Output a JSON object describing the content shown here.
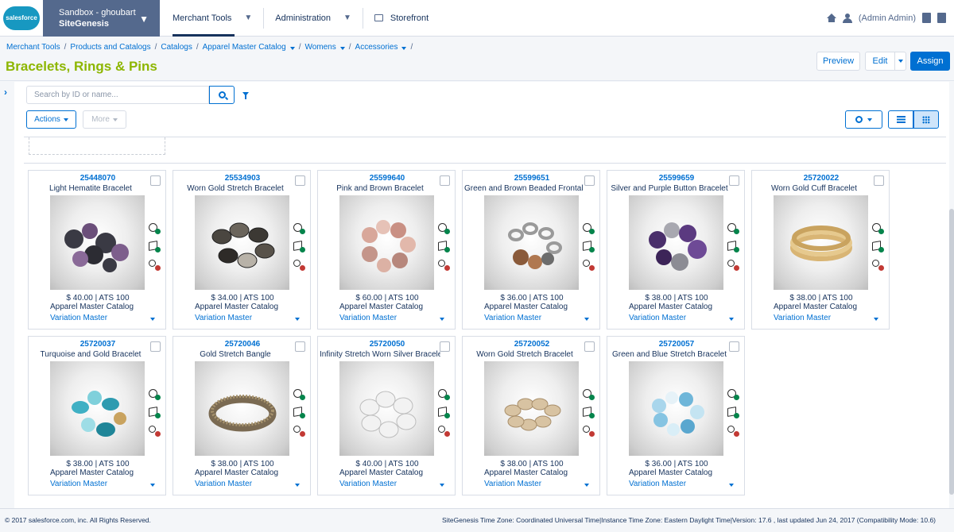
{
  "app": {
    "logo_text": "salesforce",
    "sandbox_line1": "Sandbox - ghoubart",
    "sandbox_line2": "SiteGenesis"
  },
  "nav": {
    "items": [
      {
        "label": "Merchant Tools"
      },
      {
        "label": "Administration"
      },
      {
        "label": "Storefront"
      }
    ],
    "user": "(Admin  Admin)"
  },
  "breadcrumb": [
    "Merchant Tools",
    "Products and Catalogs",
    "Catalogs",
    "Apparel Master Catalog",
    "Womens",
    "Accessories"
  ],
  "page": {
    "title": "Bracelets, Rings & Pins",
    "preview_label": "Preview",
    "edit_label": "Edit",
    "assign_label": "Assign"
  },
  "toolbar": {
    "search_placeholder": "Search by ID or name...",
    "actions_label": "Actions",
    "more_label": "More"
  },
  "products": [
    {
      "id": "25448070",
      "name": "Light Hematite Bracelet",
      "price": "$ 40.00 | ATS  100",
      "catalog": "Apparel Master Catalog",
      "type": "Variation Master",
      "kind": "hematite"
    },
    {
      "id": "25534903",
      "name": "Worn Gold Stretch Bracelet",
      "price": "$ 34.00 | ATS  100",
      "catalog": "Apparel Master Catalog",
      "type": "Variation Master",
      "kind": "discs"
    },
    {
      "id": "25599640",
      "name": "Pink and Brown Bracelet",
      "price": "$ 60.00 | ATS  100",
      "catalog": "Apparel Master Catalog",
      "type": "Variation Master",
      "kind": "pink"
    },
    {
      "id": "25599651",
      "name": "Green and Brown Beaded Frontal Cuff",
      "price": "$ 36.00 | ATS  100",
      "catalog": "Apparel Master Catalog",
      "type": "Variation Master",
      "kind": "chain"
    },
    {
      "id": "25599659",
      "name": "Silver and Purple Button Bracelet",
      "price": "$ 38.00 | ATS  100",
      "catalog": "Apparel Master Catalog",
      "type": "Variation Master",
      "kind": "purple"
    },
    {
      "id": "25720022",
      "name": "Worn Gold Cuff Bracelet",
      "price": "$ 38.00 | ATS  100",
      "catalog": "Apparel Master Catalog",
      "type": "Variation Master",
      "kind": "cuff"
    },
    {
      "id": "25720037",
      "name": "Turquoise and Gold Bracelet",
      "price": "$ 38.00 | ATS  100",
      "catalog": "Apparel Master Catalog",
      "type": "Variation Master",
      "kind": "turquoise"
    },
    {
      "id": "25720046",
      "name": "Gold Stretch Bangle",
      "price": "$ 38.00 | ATS  100",
      "catalog": "Apparel Master Catalog",
      "type": "Variation Master",
      "kind": "bangle"
    },
    {
      "id": "25720050",
      "name": "Infinity Stretch Worn Silver Bracelet",
      "price": "$ 40.00 | ATS  100",
      "catalog": "Apparel Master Catalog",
      "type": "Variation Master",
      "kind": "infinity"
    },
    {
      "id": "25720052",
      "name": "Worn Gold Stretch Bracelet",
      "price": "$ 38.00 | ATS  100",
      "catalog": "Apparel Master Catalog",
      "type": "Variation Master",
      "kind": "goldwave"
    },
    {
      "id": "25720057",
      "name": "Green and Blue Stretch Bracelet",
      "price": "$ 36.00 | ATS  100",
      "catalog": "Apparel Master Catalog",
      "type": "Variation Master",
      "kind": "blue"
    }
  ],
  "colors": {
    "accent": "#0070d2",
    "title_green": "#8db600",
    "badge_ok": "#04844b",
    "badge_no": "#c23934",
    "sandbox_bg": "#54698d"
  },
  "footer": {
    "copyright": "© 2017 salesforce.com, inc. All Rights Reserved.",
    "info": "SiteGenesis Time Zone: Coordinated Universal Time|Instance Time Zone: Eastern Daylight Time|Version: 17.6 , last updated Jun 24, 2017 (Compatibility Mode: 10.6)"
  }
}
